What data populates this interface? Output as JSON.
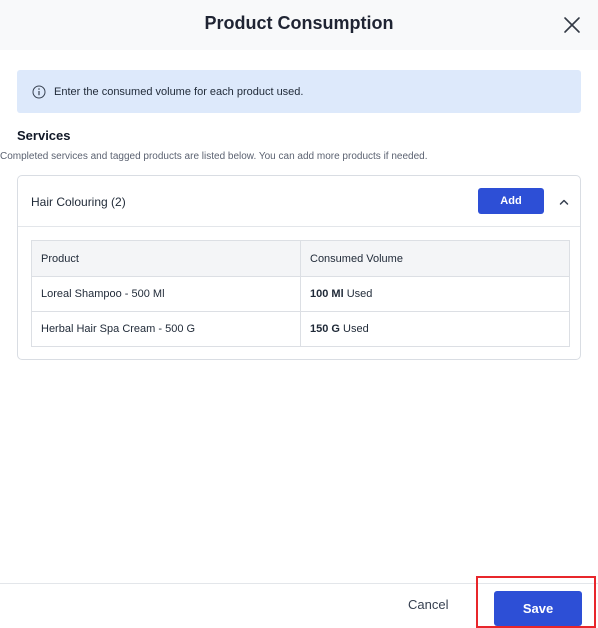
{
  "dialog": {
    "title": "Product Consumption",
    "close_icon": "close-icon"
  },
  "info": {
    "icon": "info-circle-icon",
    "text": "Enter the consumed volume for each product used."
  },
  "services": {
    "title": "Services",
    "description": "Completed services and tagged products are listed below. You can add more products if needed.",
    "items": [
      {
        "name": "Hair Colouring (2)",
        "add_label": "Add",
        "expanded": true,
        "columns": [
          "Product",
          "Consumed Volume"
        ],
        "rows": [
          {
            "product": "Loreal Shampoo - 500 Ml",
            "quantity": "100 Ml",
            "suffix": "Used"
          },
          {
            "product": "Herbal Hair Spa Cream - 500 G",
            "quantity": "150 G",
            "suffix": "Used"
          }
        ]
      }
    ]
  },
  "footer": {
    "cancel_label": "Cancel",
    "save_label": "Save"
  },
  "colors": {
    "primary": "#2d4fd6",
    "info_bg": "#dde9fb",
    "highlight": "#e8262b"
  }
}
